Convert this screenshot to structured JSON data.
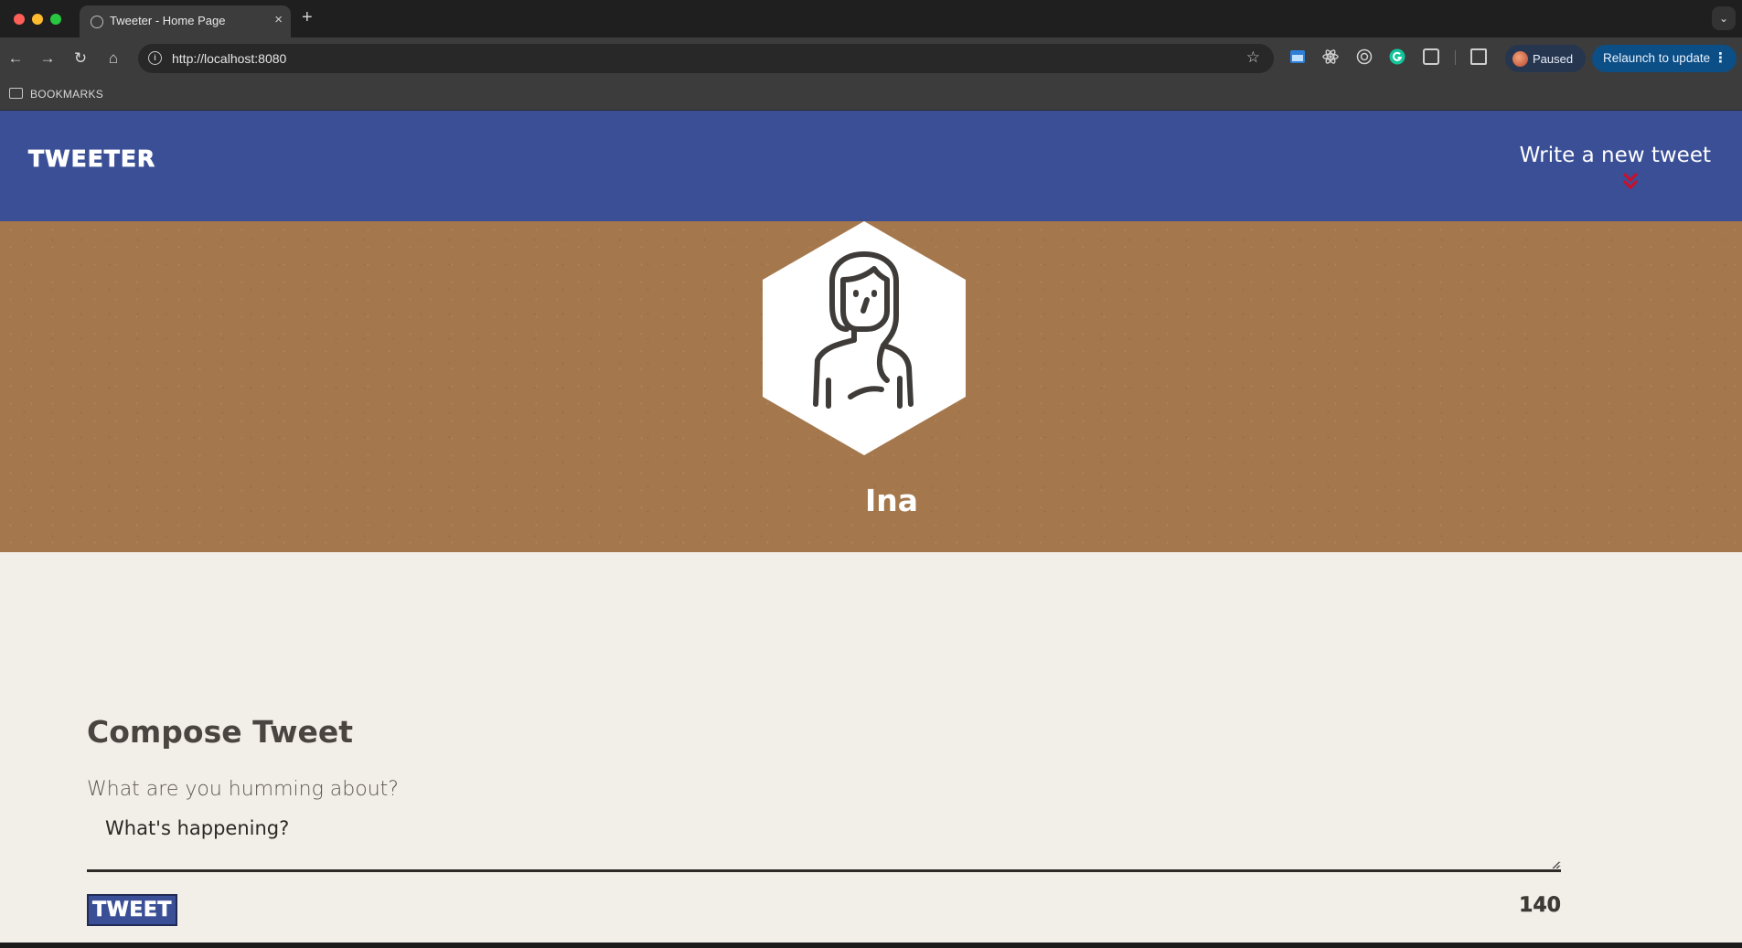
{
  "browser": {
    "tab_title": "Tweeter - Home Page",
    "tab_close": "×",
    "new_tab": "+",
    "tab_menu": "⌄",
    "url": "http://localhost:8080",
    "profile_status": "Paused",
    "relaunch_label": "Relaunch to update",
    "relaunch_menu": "⋮",
    "bookmarks_label": "BOOKMARKS",
    "back": "←",
    "forward": "→",
    "reload": "↻",
    "home": "⌂",
    "star": "☆"
  },
  "nav": {
    "brand": "TWEETER",
    "write_tweet": "Write a new tweet",
    "chevron_color": "#c8102e",
    "background": "#3a4f96"
  },
  "profile": {
    "name": "Ina",
    "avatar_icon": "woman-avatar-icon"
  },
  "compose": {
    "title": "Compose Tweet",
    "label": "What are you humming about?",
    "placeholder": "What's happening?",
    "submit_label": "TWEET",
    "char_counter": "140"
  },
  "colors": {
    "hero": "#a5774d",
    "page_bg": "#f2efe9",
    "text_dark": "#4a4540"
  }
}
